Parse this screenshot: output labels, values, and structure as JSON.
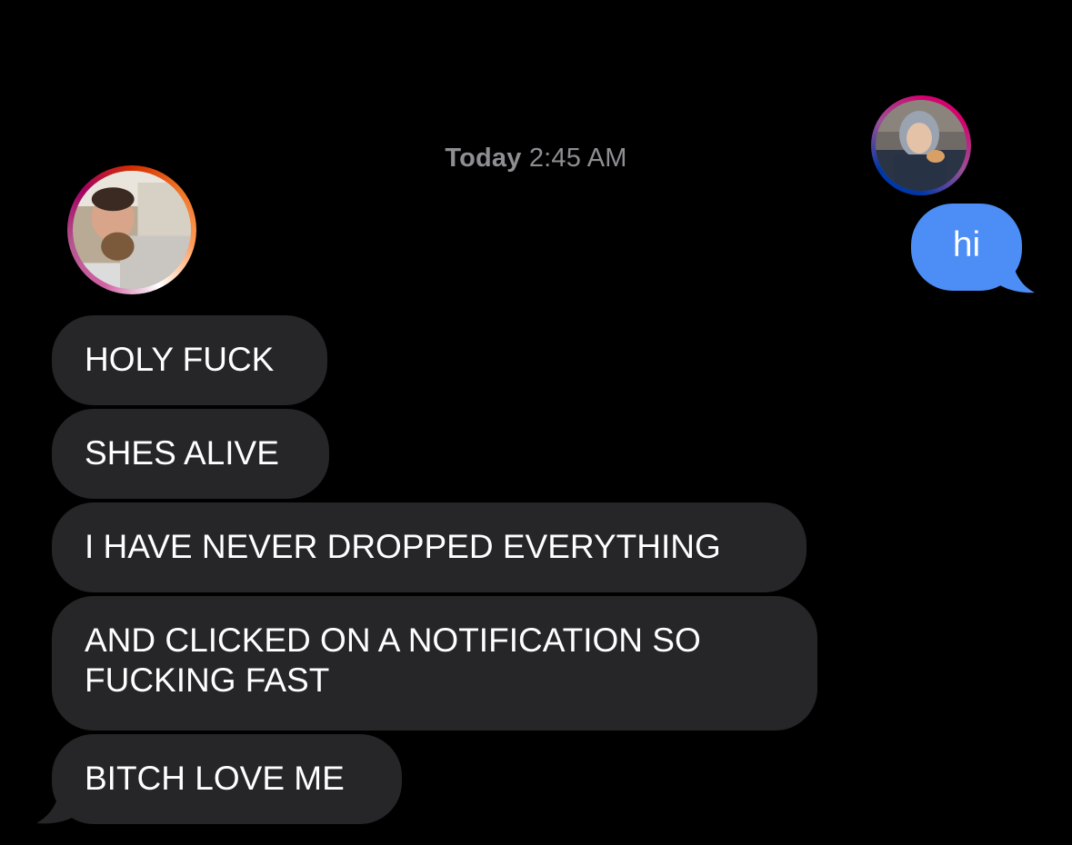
{
  "conversation": {
    "timestamp_day": "Today",
    "timestamp_time": "2:45 AM",
    "colors": {
      "background": "#000000",
      "incoming_bubble": "#262628",
      "outgoing_bubble": "#4c8df6",
      "timestamp": "#8e8e93"
    },
    "outgoing_avatar": {
      "icon": "contact-photo",
      "ring": "bisexual-flag-gradient"
    },
    "incoming_avatar": {
      "icon": "contact-photo",
      "ring": "lesbian-flag-gradient"
    },
    "outgoing_messages": [
      {
        "text": "hi"
      }
    ],
    "incoming_messages": [
      {
        "text": "HOLY FUCK"
      },
      {
        "text": "SHES ALIVE"
      },
      {
        "text": "I HAVE NEVER DROPPED EVERYTHING"
      },
      {
        "line1": "AND CLICKED ON A NOTIFICATION SO",
        "line2": "FUCKING FAST"
      },
      {
        "text": "BITCH LOVE ME"
      }
    ]
  }
}
